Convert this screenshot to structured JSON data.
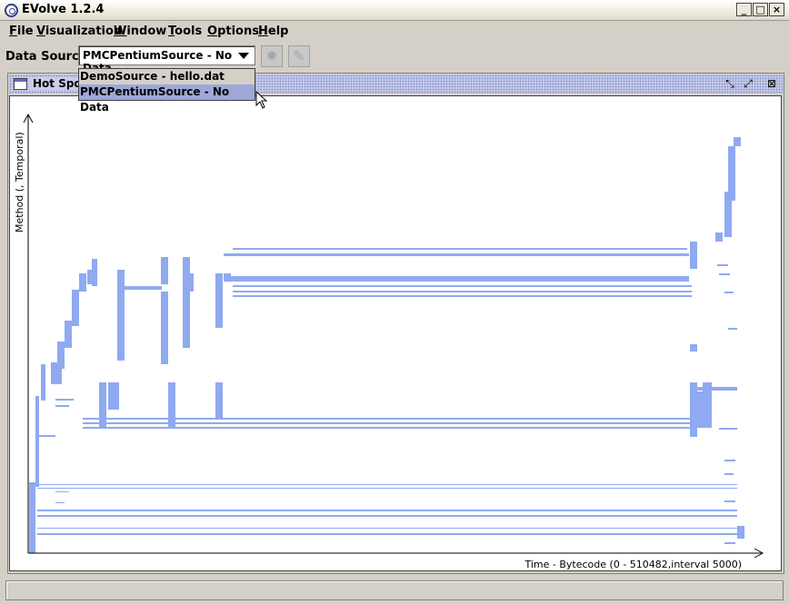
{
  "window": {
    "title": "EVolve 1.2.4"
  },
  "menu": [
    {
      "mnemonic": "F",
      "rest": "ile"
    },
    {
      "mnemonic": "V",
      "rest": "isualization"
    },
    {
      "mnemonic": "W",
      "rest": "indow"
    },
    {
      "mnemonic": "T",
      "rest": "ools"
    },
    {
      "mnemonic": "O",
      "rest": "ptions"
    },
    {
      "mnemonic": "H",
      "rest": "elp"
    }
  ],
  "toolbar": {
    "data_source_label": "Data Source:",
    "selected_source": "PMCPentiumSource - No Data",
    "options": [
      "DemoSource - hello.dat",
      "PMCPentiumSource - No Data"
    ]
  },
  "frame": {
    "title": "Hot Spot"
  },
  "chart_data": {
    "type": "hot spot scatter",
    "ylabel": "Method (, Temporal)",
    "xlabel": "Time - Bytecode (0 - 510482,interval 5000)",
    "accent": "#8faaf0"
  }
}
